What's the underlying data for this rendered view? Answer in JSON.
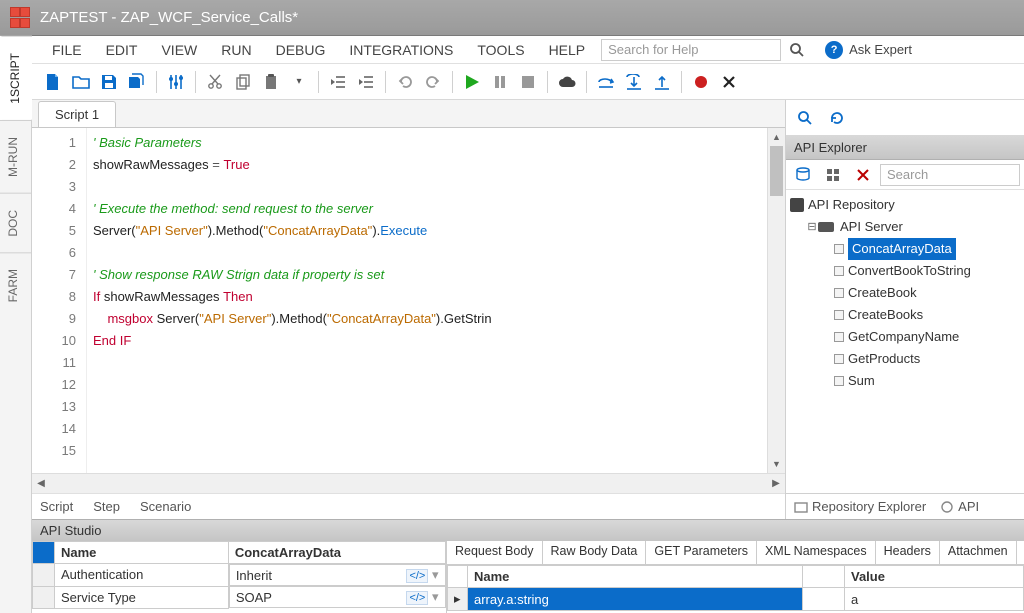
{
  "window": {
    "title": "ZAPTEST - ZAP_WCF_Service_Calls*"
  },
  "menu": {
    "file": "FILE",
    "edit": "EDIT",
    "view": "VIEW",
    "run": "RUN",
    "debug": "DEBUG",
    "integrations": "INTEGRATIONS",
    "tools": "TOOLS",
    "help": "HELP",
    "search_placeholder": "Search for Help",
    "ask": "Ask Expert"
  },
  "left_tabs": {
    "script": "1SCRIPT",
    "mrun": "M-RUN",
    "doc": "DOC",
    "farm": "FARM"
  },
  "editor_tab": "Script 1",
  "code_lines": [
    {
      "n": 1,
      "t": "comment",
      "text": "' Basic Parameters"
    },
    {
      "n": 2,
      "t": "assign",
      "lhs": "showRawMessages",
      "op": " = ",
      "rhs": "True"
    },
    {
      "n": 3,
      "t": "blank"
    },
    {
      "n": 4,
      "t": "comment",
      "text": "' Execute the method: send request to the server"
    },
    {
      "n": 5,
      "t": "call",
      "pre": "Server(",
      "s1": "\"API Server\"",
      "mid": ").Method(",
      "s2": "\"ConcatArrayData\"",
      "post": ").",
      "fn": "Execute"
    },
    {
      "n": 6,
      "t": "blank"
    },
    {
      "n": 7,
      "t": "comment",
      "text": "' Show response RAW Strign data if property is set"
    },
    {
      "n": 8,
      "t": "if",
      "kw": "If",
      "cond": " showRawMessages ",
      "kw2": "Then"
    },
    {
      "n": 9,
      "t": "msg",
      "indent": "    ",
      "kw": "msgbox",
      "sp": " ",
      "pre": "Server(",
      "s1": "\"API Server\"",
      "mid": ").Method(",
      "s2": "\"ConcatArrayData\"",
      "post": ").GetStrin"
    },
    {
      "n": 10,
      "t": "end",
      "kw": "End IF"
    },
    {
      "n": 11,
      "t": "blank"
    },
    {
      "n": 12,
      "t": "blank"
    },
    {
      "n": 13,
      "t": "blank"
    },
    {
      "n": 14,
      "t": "blank"
    },
    {
      "n": 15,
      "t": "blank"
    }
  ],
  "editor_bottom": {
    "script": "Script",
    "step": "Step",
    "scenario": "Scenario"
  },
  "api_explorer": {
    "title": "API Explorer",
    "search": "Search",
    "root": "API Repository",
    "server": "API Server",
    "methods": [
      "ConcatArrayData",
      "ConvertBookToString",
      "CreateBook",
      "CreateBooks",
      "GetCompanyName",
      "GetProducts",
      "Sum"
    ],
    "selected": "ConcatArrayData",
    "tabs": {
      "repo": "Repository Explorer",
      "api": "API "
    }
  },
  "api_studio": {
    "title": "API Studio",
    "prop_headers": {
      "name": "Name",
      "value": "ConcatArrayData"
    },
    "props": [
      {
        "name": "Authentication",
        "value": "Inherit"
      },
      {
        "name": "Service Type",
        "value": "SOAP"
      }
    ],
    "req_tabs": [
      "Request Body",
      "Raw Body Data",
      "GET Parameters",
      "XML Namespaces",
      "Headers",
      "Attachmen"
    ],
    "req_headers": {
      "name": "Name",
      "value": "Value"
    },
    "req_row": {
      "name": "array.a:string",
      "value": "a"
    }
  }
}
